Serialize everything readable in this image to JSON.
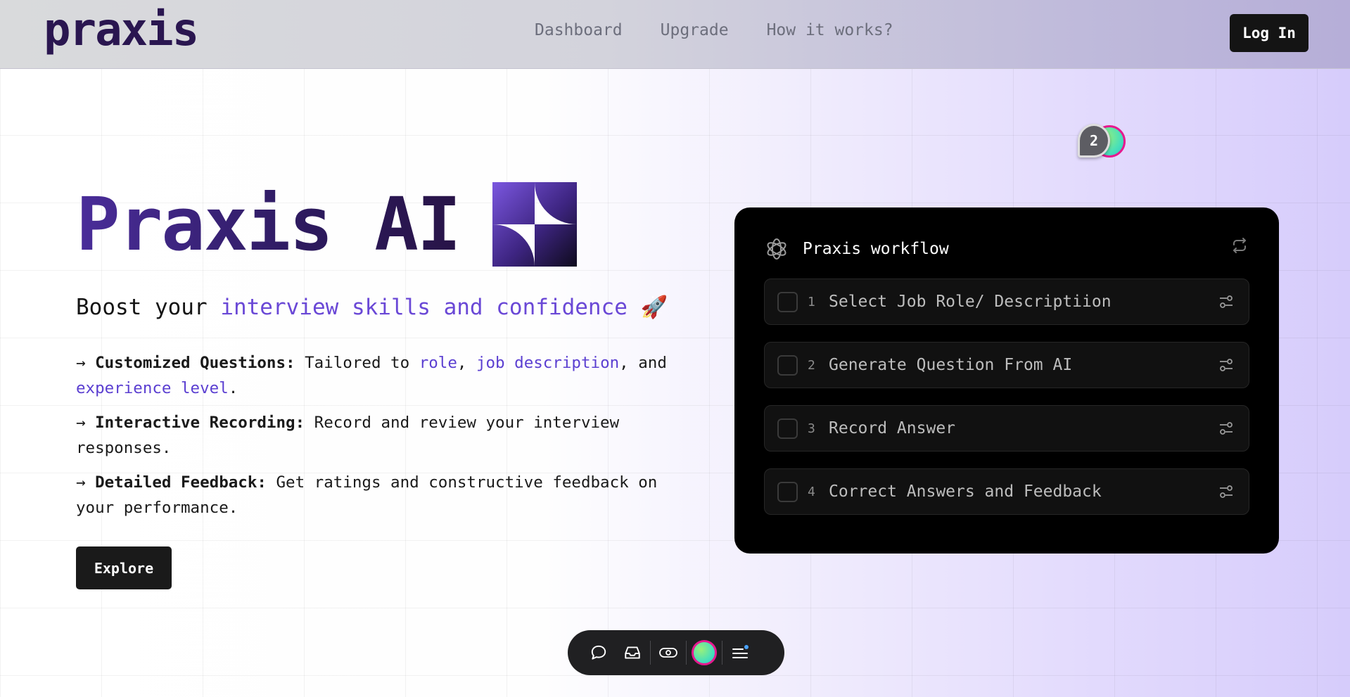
{
  "header": {
    "logo": "praxis",
    "nav": [
      "Dashboard",
      "Upgrade",
      "How it works?"
    ],
    "login_label": "Log In"
  },
  "hero": {
    "title": "Praxis AI",
    "subtitle_prefix": "Boost your ",
    "subtitle_accent": "interview skills and confidence",
    "subtitle_emoji": "🚀",
    "features": [
      {
        "arrow": "→",
        "title": "Customized Questions:",
        "text_1": " Tailored to ",
        "hl_1": "role",
        "sep_1": ", ",
        "hl_2": "job description",
        "sep_2": ", and ",
        "hl_3": "experience level",
        "end": "."
      },
      {
        "arrow": "→",
        "title": "Interactive Recording:",
        "text": " Record and review your interview responses."
      },
      {
        "arrow": "→",
        "title": "Detailed Feedback:",
        "text": " Get ratings and constructive feedback on your performance."
      }
    ],
    "explore_label": "Explore"
  },
  "avatars": {
    "count_label": "2"
  },
  "workflow": {
    "title": "Praxis workflow",
    "steps": [
      {
        "num": "1",
        "label": "Select Job Role/ Descriptiion"
      },
      {
        "num": "2",
        "label": "Generate Question From AI"
      },
      {
        "num": "3",
        "label": "Record Answer"
      },
      {
        "num": "4",
        "label": "Correct Answers and Feedback"
      }
    ]
  },
  "colors": {
    "accent": "#6a48d6",
    "title_gradient_start": "#4a2d9a",
    "title_gradient_end": "#281447",
    "avatar_ring": "#e6198f",
    "notification_dot": "#4aa3ff"
  },
  "icons": {
    "workflow_logo": "openai-icon",
    "workflow_refresh": "repeat-icon",
    "step_settings": "sliders-icon",
    "toolbar": [
      "comment-icon",
      "inbox-icon",
      "eye-icon",
      "avatar",
      "menu-icon"
    ]
  }
}
